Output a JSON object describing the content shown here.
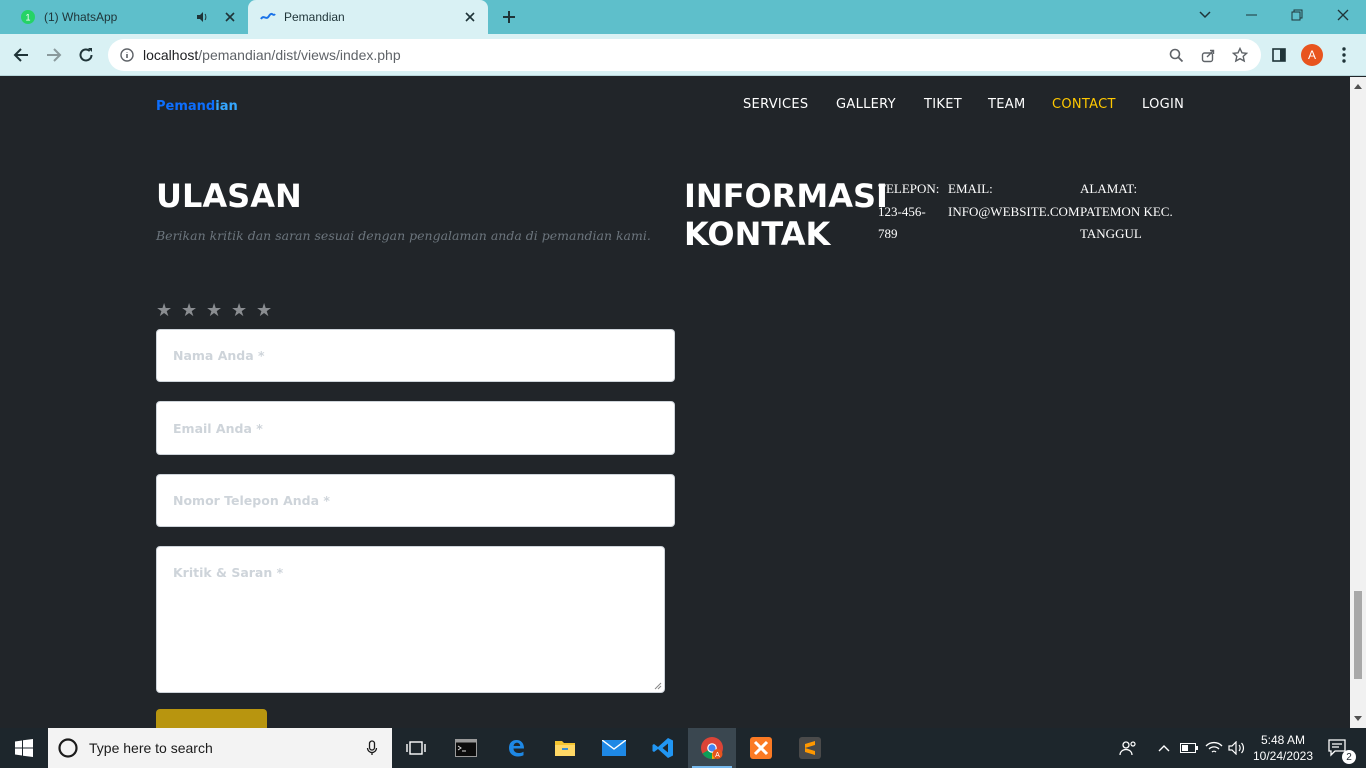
{
  "browser": {
    "tabs": [
      {
        "title": "(1) WhatsApp",
        "favicon": "whatsapp-icon",
        "audible": true
      },
      {
        "title": "Pemandian",
        "favicon": "pemandian-icon",
        "active": true
      }
    ],
    "url_host": "localhost",
    "url_path": "/pemandian/dist/views/index.php",
    "profile_initial": "A"
  },
  "header": {
    "logo": {
      "part1": "Pemand",
      "part2": "ian"
    },
    "nav": [
      "SERVICES",
      "GALLERY",
      "TIKET",
      "TEAM",
      "CONTACT",
      "LOGIN"
    ],
    "active_nav": "CONTACT"
  },
  "review": {
    "title": "ULASAN",
    "subtitle": "Berikan kritik dan saran sesuai dengan pengalaman anda di pemandian kami.",
    "stars": [
      "★",
      "★",
      "★",
      "★",
      "★"
    ],
    "name_placeholder": "Nama Anda *",
    "email_placeholder": "Email Anda *",
    "phone_placeholder": "Nomor Telepon Anda *",
    "message_placeholder": "Kritik & Saran *"
  },
  "contact": {
    "title_line1": "INFORMASI",
    "title_line2": "KONTAK",
    "phone_label": "TELEPON:",
    "phone_value_1": "123-456-",
    "phone_value_2": "789",
    "email_label": "EMAIL:",
    "email_value": "INFO@WEBSITE.COM",
    "address_label": "ALAMAT:",
    "address_line_1": "PATEMON KEC.",
    "address_line_2": "TANGGUL"
  },
  "taskbar": {
    "search_placeholder": "Type here to search",
    "time": "5:48 AM",
    "date": "10/24/2023",
    "notification_count": "2"
  },
  "colors": {
    "page_bg": "#212529",
    "accent_nav": "#ffc800",
    "logo_blue": "#2196f3",
    "button_gold": "#b8950f",
    "tabbar": "#5ebfcb"
  }
}
